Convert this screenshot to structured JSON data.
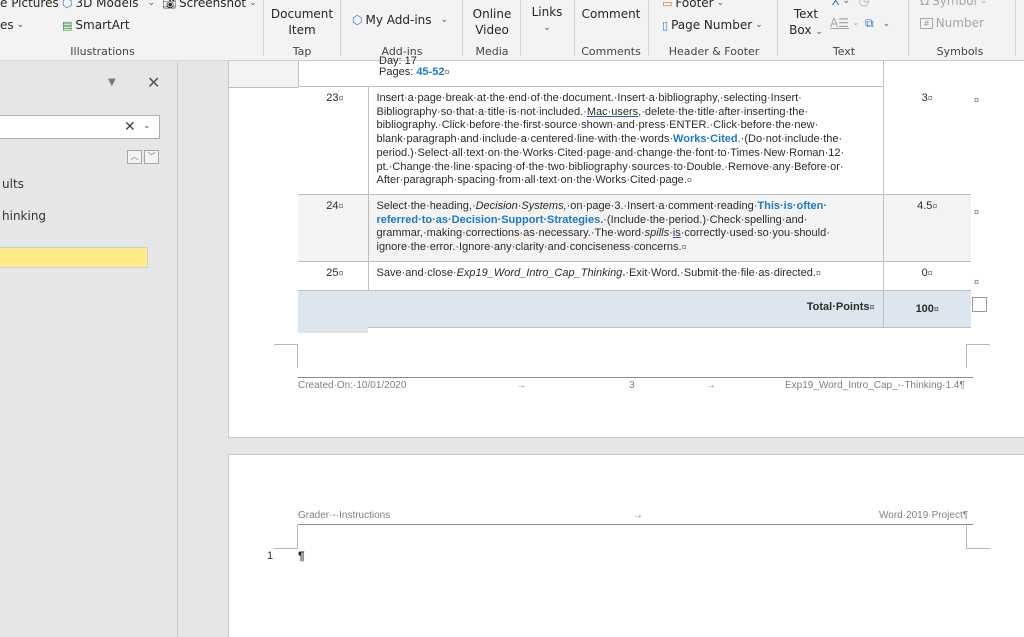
{
  "ribbon": {
    "illustrations": {
      "pictures_label": "e Pictures",
      "models_label": "3D Models",
      "screenshot_label": "Screenshot",
      "shapes_label": "es",
      "smartart_label": "SmartArt",
      "group_label": "Illustrations"
    },
    "tap": {
      "document_item_line1": "Document",
      "document_item_line2": "Item",
      "group_label": "Tap"
    },
    "addins": {
      "my_addins_label": "My Add-ins",
      "group_label": "Add-ins"
    },
    "media": {
      "online_video_line1": "Online",
      "online_video_line2": "Video",
      "group_label": "Media"
    },
    "links": {
      "label": "Links"
    },
    "comments": {
      "comment_label": "Comment",
      "group_label": "Comments"
    },
    "header_footer": {
      "footer_label": "Footer",
      "page_number_label": "Page Number",
      "group_label": "Header & Footer"
    },
    "text": {
      "text_box_line1": "Text",
      "text_box_line2": "Box",
      "group_label": "Text"
    },
    "symbols": {
      "symbol_label": "Symbol",
      "number_label": "Number",
      "group_label": "Symbols"
    }
  },
  "nav_pane": {
    "search_value": "",
    "results": [
      {
        "label": "ults"
      },
      {
        "label": "hinking"
      }
    ],
    "highlighted_result": ""
  },
  "document": {
    "prev_row": {
      "partial_line": "Day: 17",
      "pages_label": "Pages:",
      "pages_value": "45-52",
      "cell_mark": "¤"
    },
    "rows": [
      {
        "number": "23",
        "points": "3",
        "description_parts": {
          "a": "Insert·a·page·break·at·the·end·of·the·document.·Insert·a·bibliography,·selecting·Insert· Bibliography·so·that·a·title·is·not·included.·",
          "b": "Mac·users,",
          "c": "·delete·the·title·after·inserting·the· bibliography.·Click·before·the·first·source·shown·and·press·ENTER.·Click·before·the·new· blank·paragraph·and·include·a·centered·line·with·the·words·",
          "d": "Works·Cited",
          "e": ".·(Do·not·include·the· period.)·Select·all·text·on·the·Works·Cited·page·and·change·the·font·to·Times·New·Roman·12· pt.·Change·the·line·spacing·of·the·two·bibliography·sources·to·Double.·Remove·any·Before·or· After·paragraph·spacing·from·all·text·on·the·Works·Cited·page."
        }
      },
      {
        "number": "24",
        "points": "4.5",
        "description_parts": {
          "a": "Select·the·heading,·",
          "b": "Decision·Systems,",
          "c": "·on·page·3.·Insert·a·comment·reading·",
          "d": "This·is·often· referred·to·as·Decision·Support·Strategies.",
          "e": "·(Include·the·period.)·Check·spelling·and· grammar,·making·corrections·as·necessary.·The·word·",
          "f": "spills",
          "g": "·",
          "h": "is",
          "i": "·correctly·used·so·you·should· ignore·the·error.·Ignore·any·clarity·and·conciseness·concerns."
        }
      },
      {
        "number": "25",
        "points": "0",
        "description_parts": {
          "a": "Save·and·close·",
          "b": "Exp19_Word_Intro_Cap_Thinking",
          "c": ".",
          "d": "·Exit·Word.·Submit·the·file·as·directed."
        }
      }
    ],
    "total": {
      "label": "Total·Points",
      "value": "100"
    },
    "cell_mark": "¤",
    "page3_footer": {
      "left": "Created·On:·10/01/2020",
      "tab1": "→",
      "page_number": "3",
      "tab2": "→",
      "right": "Exp19_Word_Intro_Cap_-·Thinking·1.4¶"
    },
    "page4_header": {
      "left": "Grader·-·Instructions",
      "tab": "→",
      "right": "Word·2019·Project¶"
    },
    "page4_body": {
      "line_number": "1",
      "pilcrow": "¶"
    }
  },
  "colors": {
    "ribbon_bg": "#f3f3f3",
    "workspace_bg": "#e6e6e6",
    "link_blue": "#1f7ac3",
    "total_row_bg": "#dde6ef",
    "nav_highlight": "#ffeb8a"
  }
}
